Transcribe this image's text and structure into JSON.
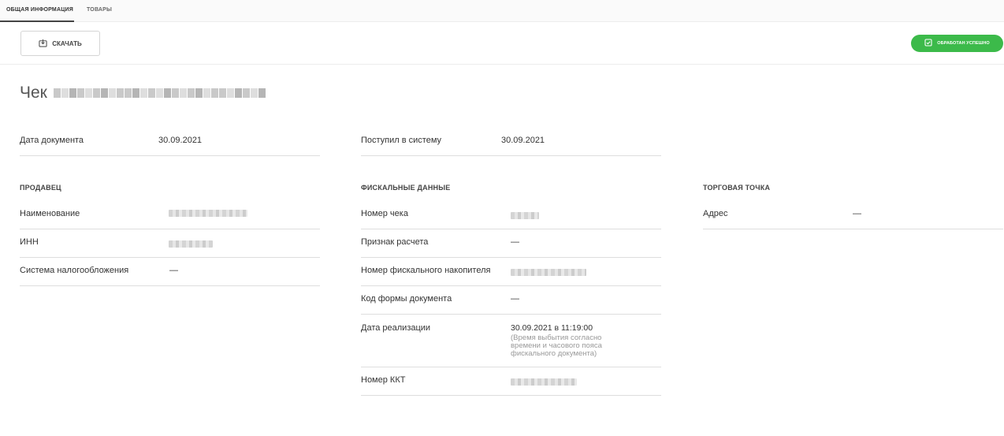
{
  "tabs": [
    {
      "label": "ОБЩАЯ ИНФОРМАЦИЯ"
    },
    {
      "label": "ТОВАРЫ"
    }
  ],
  "toolbar": {
    "download_label": "СКАЧАТЬ",
    "status_label": "ОБРАБОТАН УСПЕШНО"
  },
  "colors": {
    "status_green": "#3cba4a"
  },
  "page": {
    "title": "Чек"
  },
  "top_fields": {
    "doc_date_label": "Дата документа",
    "doc_date_value": "30.09.2021",
    "received_label": "Поступил в систему",
    "received_value": "30.09.2021"
  },
  "seller": {
    "heading": "ПРОДАВЕЦ",
    "name_label": "Наименование",
    "inn_label": "ИНН",
    "tax_label": "Система налогообложения",
    "tax_value": "—"
  },
  "fiscal": {
    "heading": "ФИСКАЛЬНЫЕ ДАННЫЕ",
    "receipt_no_label": "Номер чека",
    "calc_sign_label": "Признак расчета",
    "calc_sign_value": "—",
    "fn_label": "Номер фискального накопителя",
    "form_code_label": "Код формы документа",
    "form_code_value": "—",
    "sale_date_label": "Дата реализации",
    "sale_date_value": "30.09.2021 в 11:19:00",
    "sale_date_note_1": "(Время выбытия согласно",
    "sale_date_note_2": "времени и часового пояса",
    "sale_date_note_3": "фискального документа)",
    "kkt_label": "Номер ККТ"
  },
  "outlet": {
    "heading": "ТОРГОВАЯ ТОЧКА",
    "address_label": "Адрес",
    "address_value": "—"
  }
}
